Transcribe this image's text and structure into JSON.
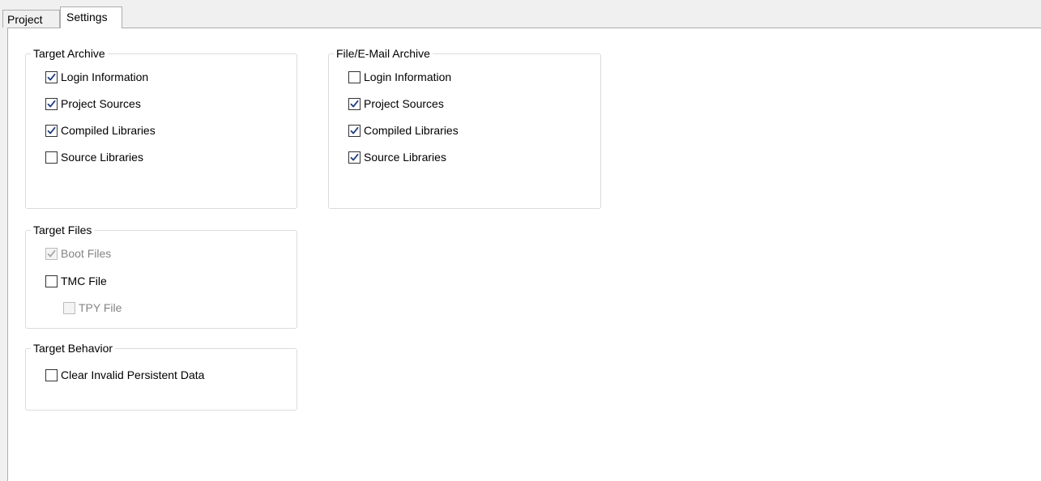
{
  "tabs": [
    {
      "label": "Project",
      "selected": false
    },
    {
      "label": "Settings",
      "selected": true
    }
  ],
  "target_archive": {
    "title": "Target Archive",
    "items": [
      {
        "label": "Login Information",
        "checked": true,
        "enabled": true
      },
      {
        "label": "Project Sources",
        "checked": true,
        "enabled": true
      },
      {
        "label": "Compiled Libraries",
        "checked": true,
        "enabled": true
      },
      {
        "label": "Source Libraries",
        "checked": false,
        "enabled": true
      }
    ]
  },
  "file_email_archive": {
    "title": "File/E-Mail Archive",
    "items": [
      {
        "label": "Login Information",
        "checked": false,
        "enabled": true
      },
      {
        "label": "Project Sources",
        "checked": true,
        "enabled": true
      },
      {
        "label": "Compiled Libraries",
        "checked": true,
        "enabled": true
      },
      {
        "label": "Source Libraries",
        "checked": true,
        "enabled": true
      }
    ]
  },
  "target_files": {
    "title": "Target Files",
    "items": [
      {
        "label": "Boot Files",
        "checked": true,
        "enabled": false
      },
      {
        "label": "TMC File",
        "checked": false,
        "enabled": true
      },
      {
        "label": "TPY File",
        "checked": false,
        "enabled": false
      }
    ]
  },
  "target_behavior": {
    "title": "Target Behavior",
    "items": [
      {
        "label": "Clear Invalid Persistent Data",
        "checked": false,
        "enabled": true
      }
    ]
  },
  "colors": {
    "check_enabled": "#1f3b80",
    "check_disabled": "#a8a8a8",
    "disabled_text": "#838383"
  }
}
